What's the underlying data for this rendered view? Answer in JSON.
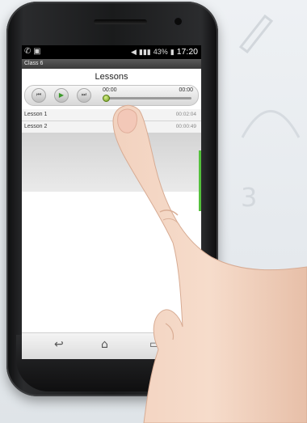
{
  "status_bar": {
    "left_icons": "✆ ▣",
    "battery": "43%",
    "time": "17:20"
  },
  "title_bar": {
    "label": "Class 6"
  },
  "screen_title": "Lessons",
  "player": {
    "prev_icon": "⏮",
    "play_icon": "▶",
    "next_icon": "⏭",
    "current_time": "00:00",
    "total_time": "00:00",
    "progress": 0
  },
  "lessons": [
    {
      "title": "Lesson 1",
      "duration": "00:02:04"
    },
    {
      "title": "Lesson 2",
      "duration": "00:00:49"
    }
  ],
  "nav": {
    "back_icon": "↩",
    "home_icon": "⌂",
    "recent_icon": "▭"
  },
  "colors": {
    "accent_green": "#55c13d",
    "status_bar": "#000000"
  },
  "doodles": {
    "digits": "3"
  }
}
